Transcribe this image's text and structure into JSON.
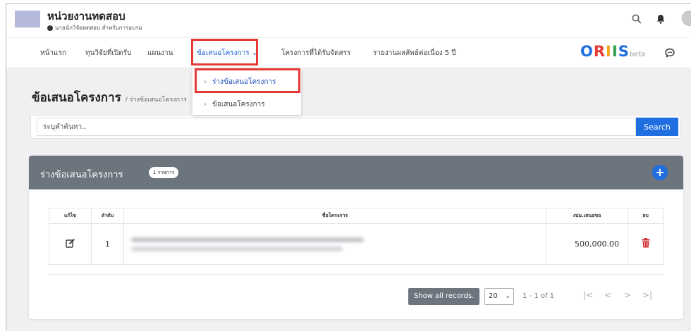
{
  "header": {
    "org_name": "หน่วยงานทดสอบ",
    "user_line": "นายนักวิจัยทดสอบ สำหรับการอบรม"
  },
  "icons": {
    "search": "search-icon",
    "bell": "bell-icon",
    "user": "user-icon",
    "chat": "chat-icon",
    "edit": "edit-icon",
    "trash": "trash-icon",
    "plus": "plus-icon",
    "chevron": "chevron-right-icon"
  },
  "nav": {
    "items": [
      {
        "label": "หน้าแรก"
      },
      {
        "label": "ทุนวิจัยที่เปิดรับ"
      },
      {
        "label": "แผนงาน"
      },
      {
        "label": "ข้อเสนอโครงการ",
        "caret": "⌄"
      },
      {
        "label": "โครงการที่ได้รับจัดสรร"
      },
      {
        "label": "รายงานผลลัพธ์ต่อเนื่อง 5 ปี"
      }
    ],
    "brand": {
      "O": "O",
      "R": "R",
      "I1": "I",
      "I2": "I",
      "S": "S",
      "beta": "beta"
    }
  },
  "brand_colors": {
    "O": "#1f6fe0",
    "R": "#e53935",
    "I1": "#f5a623",
    "I2": "#2e9e4f",
    "S": "#1f6fe0"
  },
  "dropdown": {
    "items": [
      {
        "label": "ร่างข้อเสนอโครงการ"
      },
      {
        "label": "ข้อเสนอโครงการ"
      }
    ]
  },
  "page": {
    "title": "ข้อเสนอโครงการ",
    "breadcrumb": "/ ร่างข้อเสนอโครงการ"
  },
  "search": {
    "placeholder": "ระบุคำค้นหา..",
    "button": "Search"
  },
  "card": {
    "title": "ร่างข้อเสนอโครงการ",
    "count": "1 รายการ",
    "add": "+"
  },
  "table": {
    "headers": [
      "แก้ไข",
      "ลำดับ",
      "ชื่อโครงการ",
      "งปม.เสนอขอ",
      "ลบ"
    ],
    "rows": [
      {
        "index": "1",
        "budget": "500,000.00"
      }
    ]
  },
  "pagination": {
    "show_all": "Show all records.",
    "page_size": "20",
    "info": "1 - 1 of 1",
    "first": "|<",
    "prev": "<",
    "next": ">",
    "last": ">|"
  },
  "colors": {
    "accent": "#1f6fe0",
    "highlight": "#e53935",
    "header_gray": "#6c757d",
    "delete": "#d32f2f"
  }
}
